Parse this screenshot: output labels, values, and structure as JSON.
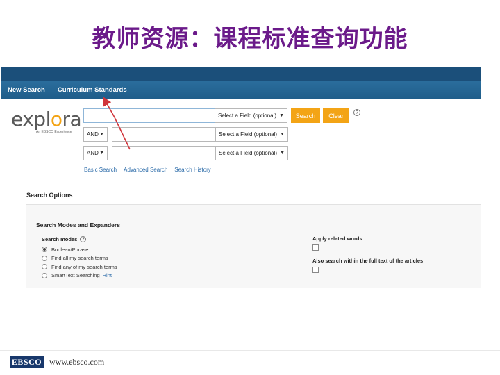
{
  "slide": {
    "title": "教师资源：课程标准查询功能"
  },
  "nav": {
    "items": [
      "New Search",
      "Curriculum Standards"
    ]
  },
  "logo": {
    "word_pre": "expl",
    "word_o": "o",
    "word_post": "ra",
    "sub": "An EBSCO Experience"
  },
  "search": {
    "row1": {
      "value": "",
      "field": "Select a Field (optional)",
      "search_label": "Search",
      "clear_label": "Clear",
      "help": "?"
    },
    "row2": {
      "bool": "AND",
      "value": "",
      "field": "Select a Field (optional)"
    },
    "row3": {
      "bool": "AND",
      "value": "",
      "field": "Select a Field (optional)"
    },
    "links": [
      "Basic Search",
      "Advanced Search",
      "Search History"
    ]
  },
  "options": {
    "title": "Search Options",
    "section": "Search Modes and Expanders",
    "modes_label": "Search modes",
    "modes": [
      "Boolean/Phrase",
      "Find all my search terms",
      "Find any of my search terms",
      "SmartText Searching"
    ],
    "selected_mode": 0,
    "hint": "Hint",
    "apply_related": "Apply related words",
    "full_text": "Also search within the full text of the articles"
  },
  "colors": {
    "accent": "#f3a416",
    "nav": "#1f5d8a",
    "title": "#6b1a8a",
    "arrow": "#d0343a"
  },
  "footer": {
    "brand": "EBSCO",
    "url": "www.ebsco.com"
  }
}
